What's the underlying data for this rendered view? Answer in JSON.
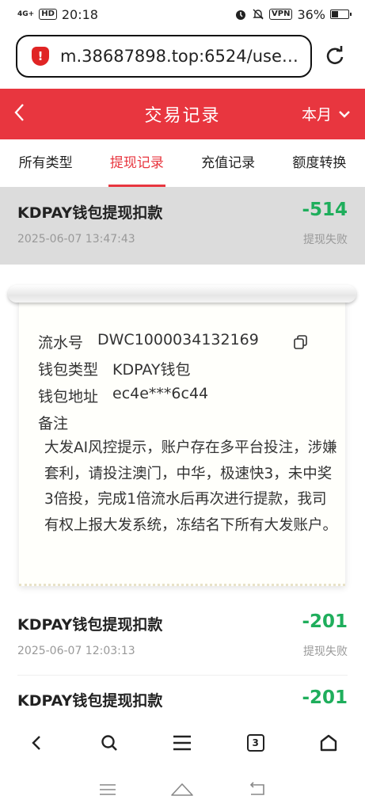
{
  "status_bar": {
    "signal": "4G+",
    "hd": "HD",
    "time": "20:18",
    "vpn": "VPN",
    "battery": "36%",
    "battery_level": 0.36
  },
  "browser": {
    "url": "m.38687898.top:6524/use…",
    "warning_symbol": "!"
  },
  "header": {
    "back_glyph": "<",
    "title": "交易记录",
    "period": "本月"
  },
  "tabs": [
    {
      "label": "所有类型",
      "active": false
    },
    {
      "label": "提现记录",
      "active": true
    },
    {
      "label": "充值记录",
      "active": false
    },
    {
      "label": "额度转换",
      "active": false
    }
  ],
  "records": [
    {
      "name": "KDPAY钱包提现扣款",
      "amount": "-514",
      "time": "2025-06-07 13:47:43",
      "status": "提现失败"
    },
    {
      "name": "KDPAY钱包提现扣款",
      "amount": "-201",
      "time": "2025-06-07 12:03:13",
      "status": "提现失败"
    },
    {
      "name": "KDPAY钱包提现扣款",
      "amount": "-201"
    }
  ],
  "detail": {
    "serial_label": "流水号",
    "serial_value": "DWC1000034132169",
    "wallet_type_label": "钱包类型",
    "wallet_type_value": "KDPAY钱包",
    "wallet_addr_label": "钱包地址",
    "wallet_addr_value": "ec4e***6c44",
    "remark_label": "备注",
    "remark_text": "大发AI风控提示，账户存在多平台投注，涉嫌套利，请投注澳门，中华，极速快3，未中奖3倍投，完成1倍流水后再次进行提款，我司有权上报大发系统，冻结名下所有大发账户。"
  },
  "bottom_nav": {
    "tab_count": "3"
  }
}
